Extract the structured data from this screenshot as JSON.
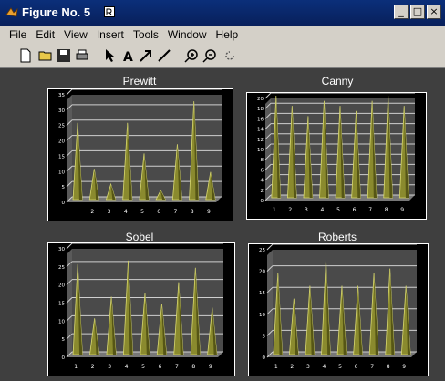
{
  "window": {
    "title": "Figure No. 5"
  },
  "menu": [
    "File",
    "Edit",
    "View",
    "Insert",
    "Tools",
    "Window",
    "Help"
  ],
  "toolbar": {
    "icons": [
      "new-file-icon",
      "open-folder-icon",
      "save-icon",
      "print-icon",
      "pointer-arrow-icon",
      "text-tool-icon",
      "arrow-tool-icon",
      "line-tool-icon",
      "zoom-in-icon",
      "zoom-out-icon",
      "rotate-icon"
    ]
  },
  "charts": [
    {
      "title": "Prewitt"
    },
    {
      "title": "Canny"
    },
    {
      "title": "Sobel"
    },
    {
      "title": "Roberts"
    }
  ],
  "chart_data": [
    {
      "type": "bar",
      "title": "Prewitt",
      "categories": [
        "1",
        "2",
        "3",
        "4",
        "5",
        "6",
        "7",
        "8",
        "9"
      ],
      "x_tick_labels": [
        "",
        "2",
        "3",
        "4",
        "5",
        "6",
        "7",
        "8",
        "9"
      ],
      "values": [
        25,
        10,
        5,
        25,
        15,
        3,
        18,
        32,
        9
      ],
      "ylim": [
        0,
        35
      ],
      "yticks": [
        0,
        5,
        10,
        15,
        20,
        25,
        30,
        35
      ]
    },
    {
      "type": "bar",
      "title": "Canny",
      "categories": [
        "1",
        "2",
        "3",
        "4",
        "5",
        "6",
        "7",
        "8",
        "9"
      ],
      "x_tick_labels": [
        "1",
        "2",
        "3",
        "4",
        "5",
        "6",
        "7",
        "8",
        "9"
      ],
      "values": [
        20,
        18,
        16,
        19,
        18,
        17,
        19,
        20,
        18
      ],
      "ylim": [
        0,
        20
      ],
      "yticks": [
        0,
        2,
        4,
        6,
        8,
        10,
        12,
        14,
        16,
        18,
        20
      ]
    },
    {
      "type": "bar",
      "title": "Sobel",
      "categories": [
        "1",
        "2",
        "3",
        "4",
        "5",
        "6",
        "7",
        "8",
        "9"
      ],
      "x_tick_labels": [
        "1",
        "2",
        "3",
        "4",
        "5",
        "6",
        "7",
        "8",
        "9"
      ],
      "values": [
        25,
        10,
        16,
        26,
        17,
        14,
        20,
        24,
        13
      ],
      "ylim": [
        0,
        30
      ],
      "yticks": [
        0,
        5,
        10,
        15,
        20,
        25,
        30
      ]
    },
    {
      "type": "bar",
      "title": "Roberts",
      "categories": [
        "1",
        "2",
        "3",
        "4",
        "5",
        "6",
        "7",
        "8",
        "9"
      ],
      "x_tick_labels": [
        "1",
        "2",
        "3",
        "4",
        "5",
        "6",
        "7",
        "8",
        "9"
      ],
      "values": [
        19,
        13,
        16,
        22,
        16,
        16,
        19,
        20,
        16
      ],
      "ylim": [
        0,
        25
      ],
      "yticks": [
        0,
        5,
        10,
        15,
        20,
        25
      ]
    }
  ]
}
